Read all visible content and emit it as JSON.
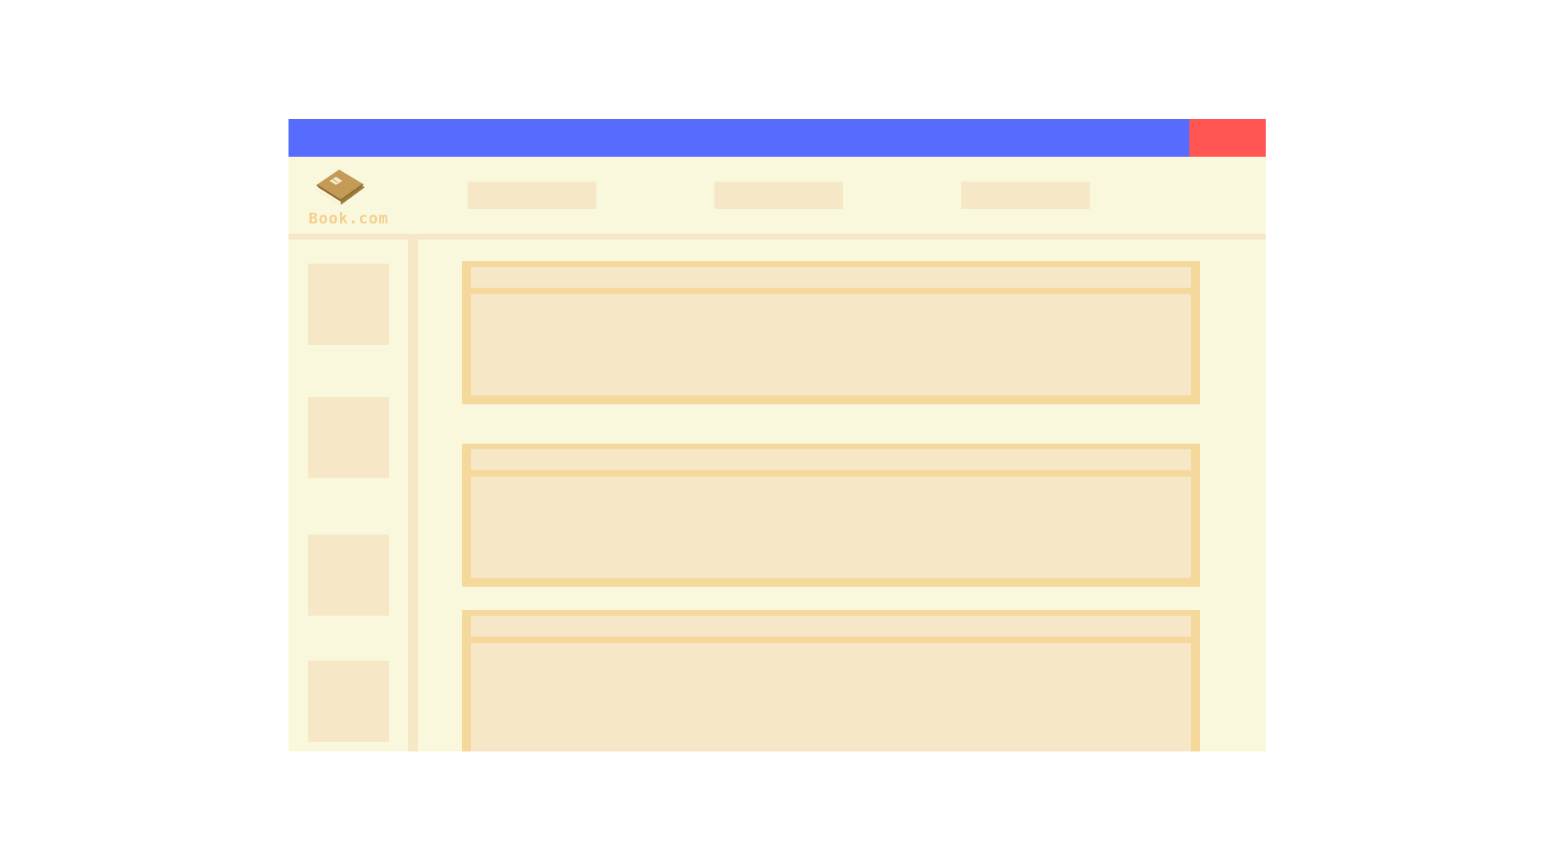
{
  "window": {
    "titlebar_color": "#576bfe",
    "close_button_color": "#ff5654",
    "background_color": "#f9f8dc"
  },
  "header": {
    "logo": {
      "icon": "book-icon",
      "text": "Book.com",
      "text_color": "#f4cf8f"
    },
    "nav_items": [
      {
        "label": ""
      },
      {
        "label": ""
      },
      {
        "label": ""
      }
    ]
  },
  "sidebar": {
    "items": [
      {
        "label": ""
      },
      {
        "label": ""
      },
      {
        "label": ""
      },
      {
        "label": ""
      }
    ]
  },
  "main": {
    "cards": [
      {
        "title": "",
        "content": ""
      },
      {
        "title": "",
        "content": ""
      },
      {
        "title": "",
        "content": ""
      }
    ]
  },
  "colors": {
    "placeholder_fill": "#f6e7c7",
    "card_border": "#f4d89c"
  }
}
